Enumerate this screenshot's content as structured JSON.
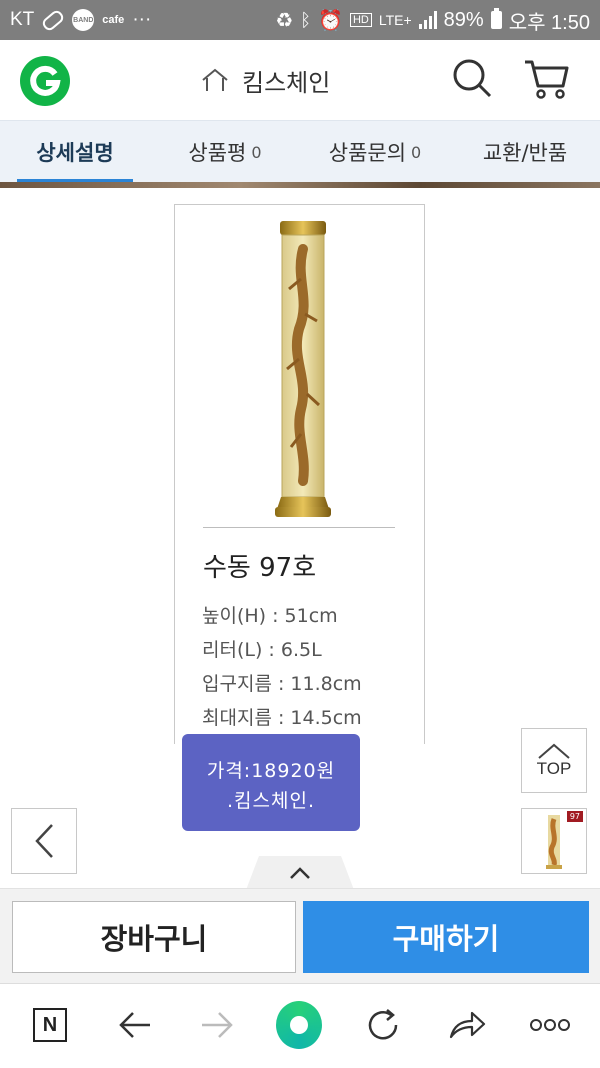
{
  "status_bar": {
    "carrier": "KT",
    "band_label": "BAND",
    "cafe_label": "cafe",
    "more_dots": "···",
    "lte_label": "LTE+",
    "battery": "89%",
    "time": "오후 1:50"
  },
  "header": {
    "title": "킴스체인"
  },
  "tabs": [
    {
      "label": "상세설명",
      "count": "",
      "active": true
    },
    {
      "label": "상품평",
      "count": "0",
      "active": false
    },
    {
      "label": "상품문의",
      "count": "0",
      "active": false
    },
    {
      "label": "교환/반품",
      "count": "",
      "active": false
    }
  ],
  "product": {
    "model": "수동 97호",
    "specs": [
      "높이(H) : 51cm",
      "리터(L) : 6.5L",
      "입구지름 : 11.8cm",
      "최대지름 : 14.5cm"
    ]
  },
  "price_popup": {
    "line1": "가격:18920원",
    "line2": ".킴스체인."
  },
  "side": {
    "top_label": "TOP",
    "thumb_badge": "97"
  },
  "actions": {
    "cart_label": "장바구니",
    "buy_label": "구매하기"
  },
  "browser_nav": {
    "n_label": "N"
  },
  "colors": {
    "brand_green": "#11b447",
    "tab_underline": "#2b84d6",
    "buy_button": "#2f8ee6",
    "price_popup": "#5c63c3"
  }
}
